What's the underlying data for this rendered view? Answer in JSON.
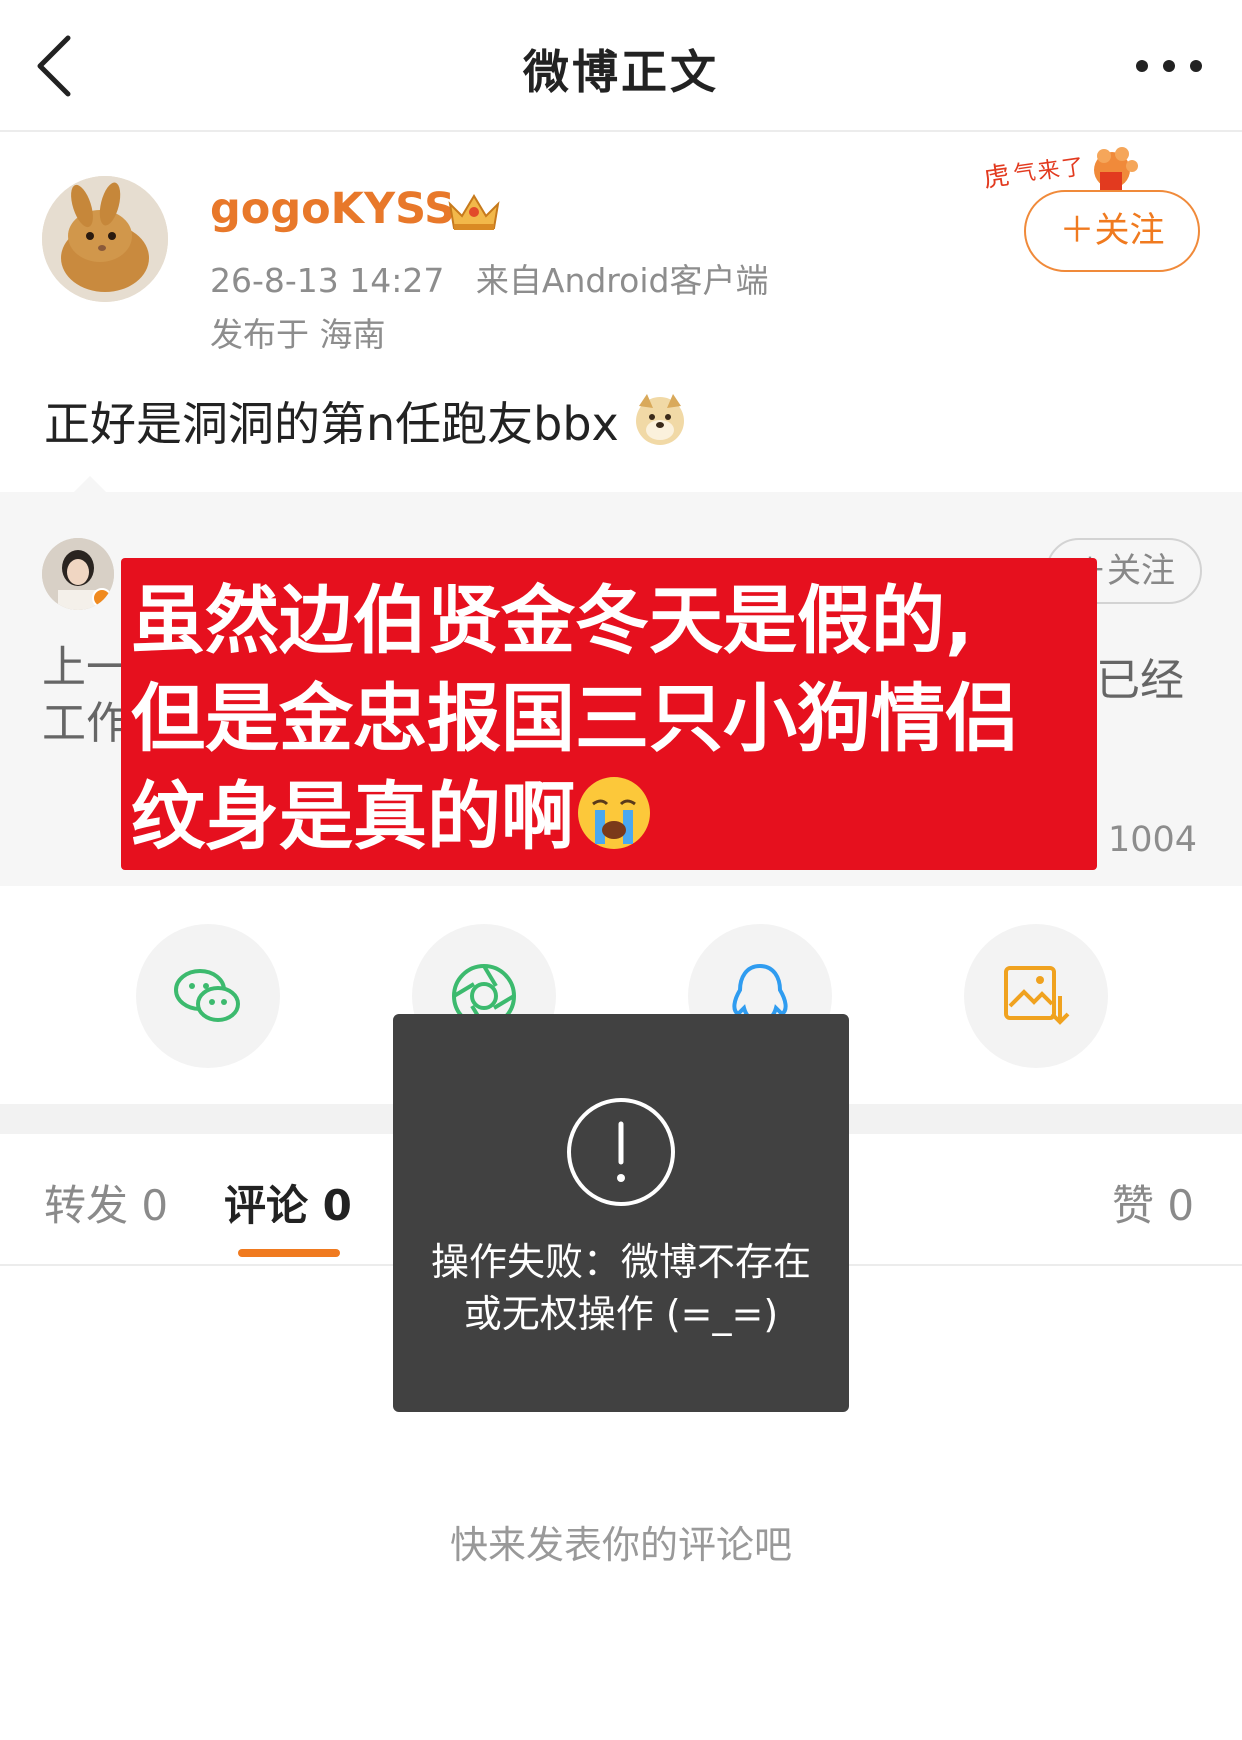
{
  "nav": {
    "title": "微博正文"
  },
  "post": {
    "username": "gogoKYSS",
    "timestamp": "26-8-13 14:27",
    "source": "来自Android客户端",
    "location": "发布于 海南",
    "follow_label": "＋关注",
    "text": "正好是洞洞的第n任跑友bbx"
  },
  "quote": {
    "follow_label": "＋关注",
    "text_left_1": "上一",
    "text_left_2": "工作",
    "text_right": "已经",
    "count": "1004"
  },
  "overlay": {
    "line1": "虽然边伯贤金冬天是假的,",
    "line2": "但是金忠报国三只小狗情侣",
    "line3": "纹身是真的啊"
  },
  "share": {
    "items": [
      "wechat-icon",
      "moments-icon",
      "qq-icon",
      "save-image-icon"
    ]
  },
  "tabs": {
    "repost": "转发 0",
    "comment": "评论 0",
    "like": "赞 0"
  },
  "comments": {
    "empty_hint": "快来发表你的评论吧"
  },
  "toast": {
    "message": "操作失败：微博不存在或无权操作 (=_=)"
  },
  "colors": {
    "accent": "#f07a1f",
    "overlay_red": "#e6101e",
    "toast_bg": "#414141"
  }
}
